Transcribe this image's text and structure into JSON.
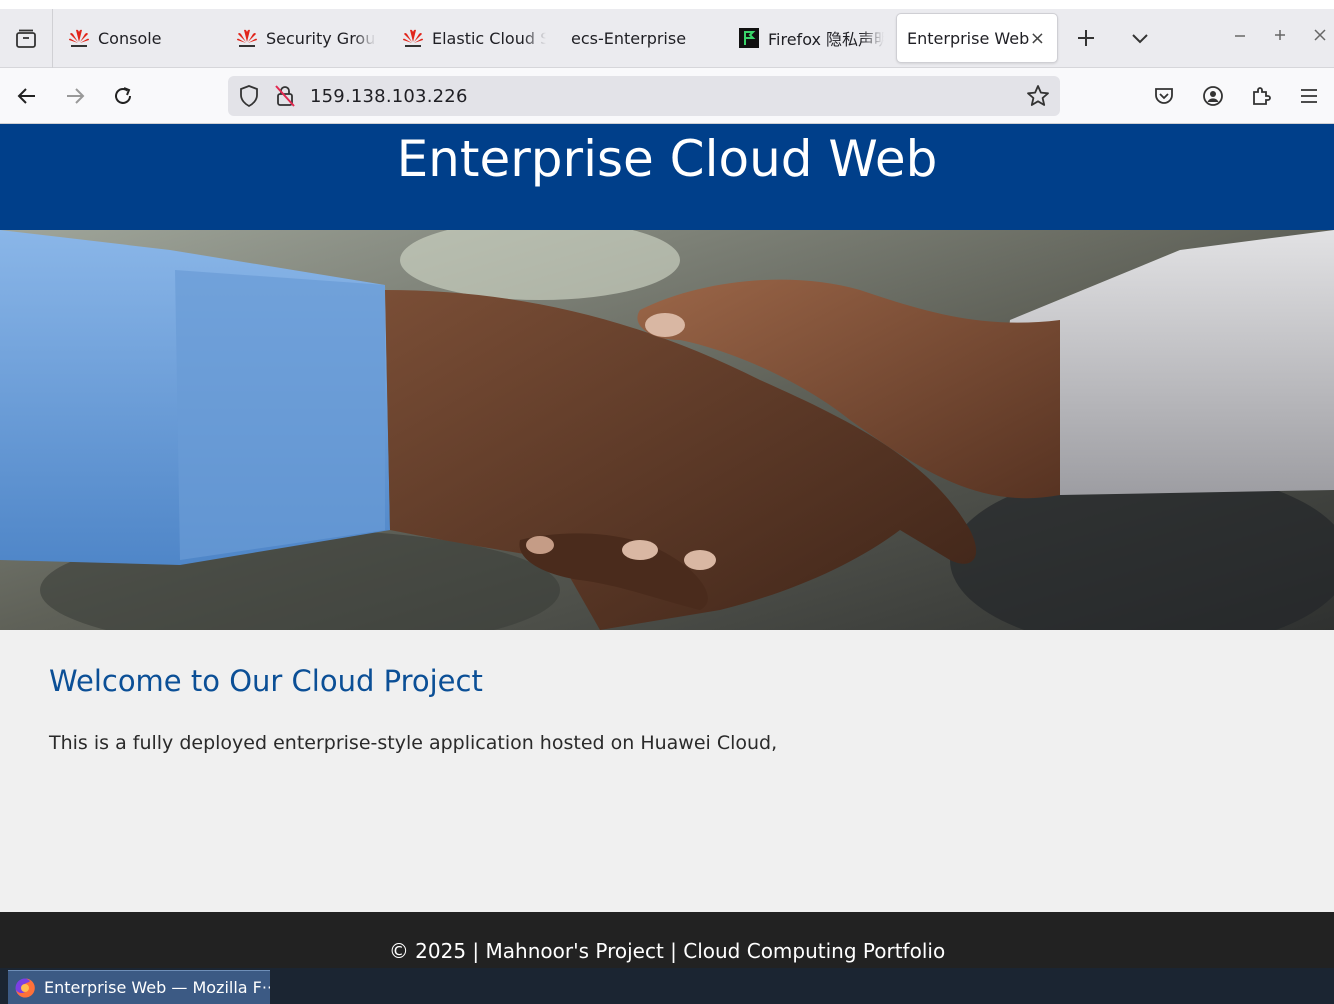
{
  "browser": {
    "tabs": [
      {
        "title": "Console",
        "favicon": "huawei-icon"
      },
      {
        "title": "Security Group",
        "favicon": "huawei-icon"
      },
      {
        "title": "Elastic Cloud S",
        "favicon": "huawei-icon"
      },
      {
        "title": "ecs-Enterprise",
        "favicon": "none"
      },
      {
        "title": "Firefox 隐私声明",
        "favicon": "firefox-privacy-icon"
      },
      {
        "title": "Enterprise Web",
        "favicon": "none",
        "active": true
      }
    ],
    "close_tab_glyph": "×",
    "new_tab_glyph": "+",
    "url": "159.138.103.226"
  },
  "page": {
    "header_title": "Enterprise Cloud Web",
    "welcome_heading": "Welcome to Our Cloud Project",
    "welcome_text": "This is a fully deployed enterprise-style application hosted on Huawei Cloud,",
    "footer_text": "© 2025 | Mahnoor's Project | Cloud Computing Portfolio"
  },
  "taskbar": {
    "window_title": "Enterprise Web — Mozilla F···"
  },
  "colors": {
    "header_bg": "#003f8a",
    "heading": "#0b4f96",
    "footer_bg": "#222222",
    "huawei_red": "#e1251b"
  }
}
